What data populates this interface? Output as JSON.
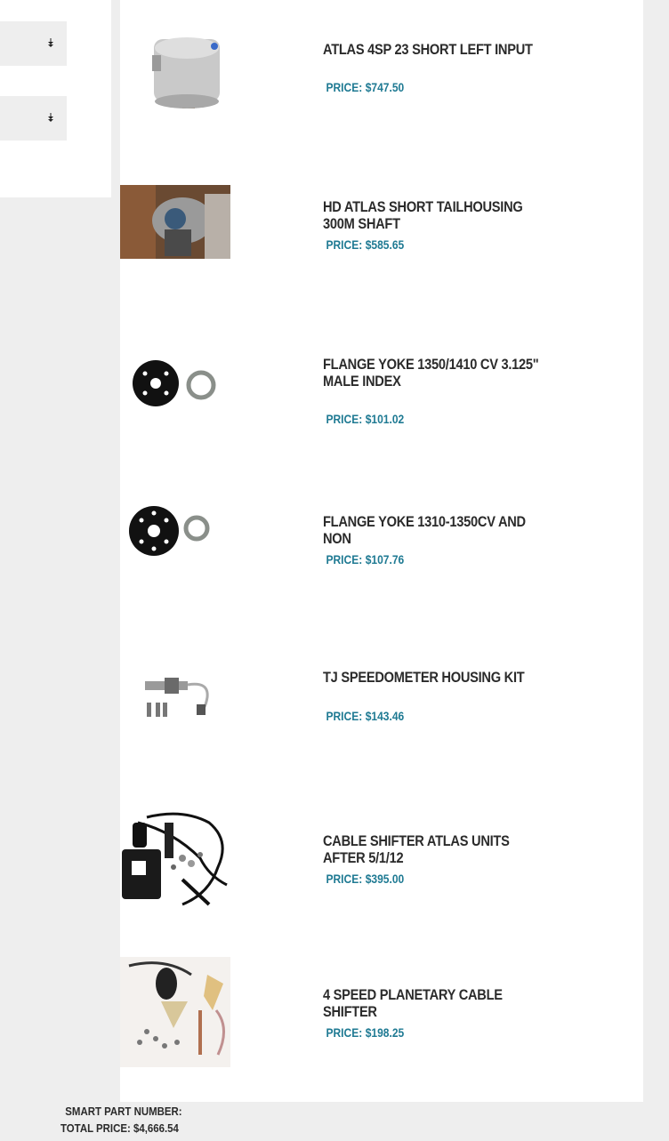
{
  "sidebar": {
    "selects": [
      {
        "icon": "dropdown-arrow-icon"
      },
      {
        "icon": "dropdown-arrow-icon"
      }
    ]
  },
  "products": [
    {
      "title": "ATLAS 4SP 23 SHORT LEFT INPUT",
      "price_label": "PRICE:",
      "price": "$747.50"
    },
    {
      "title": "HD ATLAS SHORT TAILHOUSING 300M SHAFT",
      "price_label": "PRICE:",
      "price": "$585.65"
    },
    {
      "title": "FLANGE YOKE 1350/1410 CV 3.125\" MALE INDEX",
      "price_label": "PRICE:",
      "price": "$101.02"
    },
    {
      "title": "FLANGE YOKE 1310-1350CV AND NON",
      "price_label": "PRICE:",
      "price": "$107.76"
    },
    {
      "title": "TJ SPEEDOMETER HOUSING KIT",
      "price_label": "PRICE:",
      "price": "$143.46"
    },
    {
      "title": "CABLE SHIFTER ATLAS UNITS AFTER 5/1/12",
      "price_label": "PRICE:",
      "price": "$395.00"
    },
    {
      "title": "4 SPEED PLANETARY CABLE SHIFTER",
      "price_label": "PRICE:",
      "price": "$198.25"
    }
  ],
  "footer": {
    "smart_part_label": "SMART PART NUMBER:",
    "total_label": "TOTAL PRICE:",
    "total_value": "$4,666.54"
  },
  "colors": {
    "price": "#1f7a93",
    "title": "#2b2b2b",
    "background": "#eeeeee",
    "panel": "#ffffff"
  }
}
